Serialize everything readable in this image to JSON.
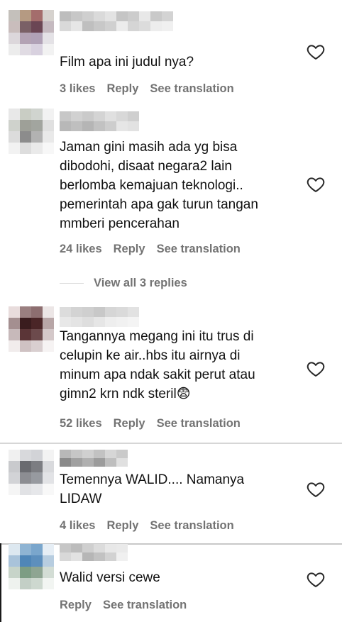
{
  "colors": {
    "meta_text": "#737373",
    "text": "#111111",
    "divider": "#d6d6d6"
  },
  "comments": [
    {
      "text": "Film apa ini judul nya?",
      "likes": "3 likes",
      "reply": "Reply",
      "translate": "See translation",
      "avatar": [
        "#c4c0bb",
        "#b59a82",
        "#a46d6c",
        "#d6d2ce",
        "#c9bdbc",
        "#7a6066",
        "#6b4654",
        "#c5bac0",
        "#dcd7db",
        "#b3a2b4",
        "#b0a1b6",
        "#e4e2e6",
        "#ececec",
        "#e0dbe3",
        "#d8d1df",
        "#f2f2f2"
      ],
      "username": [
        "#bdbdbd",
        "#d9d9d9",
        "#c7c7c7",
        "#e6e6e6",
        "#cfcfcf",
        "#bfbfbf",
        "#dadada",
        "#c8c8c8",
        "#e3e3e3",
        "#d0d0d0",
        "#c5c5c5",
        "#ececec",
        "#cccccc",
        "#d5d5d5",
        "#e8e8e8",
        "#dcdcdc",
        "#c9c9c9",
        "#ededed",
        "#d3d3d3",
        "#f0f0f0"
      ]
    },
    {
      "text": "Jaman gini masih ada yg bisa\ndibodohi, disaat negara2 lain\nberlomba kemajuan teknologi..\npemerintah apa gak turun tangan\nmmberi pencerahan",
      "likes": "24 likes",
      "reply": "Reply",
      "translate": "See translation",
      "avatar": [
        "#e8e8e8",
        "#c9cdc4",
        "#d0d4cf",
        "#f2f2f2",
        "#cfd2cc",
        "#9ea098",
        "#a2a59f",
        "#e0e0e0",
        "#dcdcdc",
        "#8c8c8c",
        "#b2b2b2",
        "#e9e9e9",
        "#f2f2f2",
        "#dddddd",
        "#eaeaea",
        "#f7f7f7"
      ],
      "username": [
        "#c7c7c7",
        "#b8b8b8",
        "#d1d1d1",
        "#bfbfbf",
        "#cacaca",
        "#b5b5b5",
        "#d4d4d4",
        "#c2c2c2",
        "#e0e0e0",
        "#cdcdcd",
        "#d8d8d8",
        "#e6e6e6",
        "#cfcfcf",
        "#e2e2e2"
      ]
    },
    {
      "text": "Tangannya megang ini itu trus di\ncelupin ke air..hbs itu airnya di\nminum apa ndak sakit perut atau\ngimn2 krn ndk steril😨",
      "likes": "52 likes",
      "reply": "Reply",
      "translate": "See translation",
      "avatar": [
        "#e8dcdc",
        "#9a7f80",
        "#8d6e70",
        "#ece6e6",
        "#a48f90",
        "#3a1c1e",
        "#4a2527",
        "#b8a6a7",
        "#c7b9ba",
        "#5b3537",
        "#6c4a4c",
        "#d4c8c9",
        "#f1ecec",
        "#cfc2c3",
        "#d9cfd0",
        "#f6f3f3"
      ],
      "username": [
        "#dcdcdc",
        "#e8e8e8",
        "#d3d3d3",
        "#e4e4e4",
        "#cfcfcf",
        "#dedede",
        "#c8c8c8",
        "#e6e6e6",
        "#d6d6d6",
        "#eeeeee",
        "#dadada",
        "#f1f1f1",
        "#e2e2e2",
        "#f4f4f4"
      ]
    },
    {
      "text": "Temennya WALID.... Namanya\nLIDAW",
      "likes": "4 likes",
      "reply": "Reply",
      "translate": "See translation",
      "avatar": [
        "#f0f0f0",
        "#d8d9dc",
        "#d2d3d7",
        "#f3f3f3",
        "#c9cacd",
        "#6a6b70",
        "#7c7d82",
        "#d9dadd",
        "#d2d3d6",
        "#8c8d92",
        "#979aa0",
        "#e2e3e6",
        "#f5f5f5",
        "#e1e2e5",
        "#e6e7ea",
        "#f8f8f8"
      ],
      "username": [
        "#b8b8b8",
        "#8a8a8a",
        "#c6c6c6",
        "#a0a0a0",
        "#d0d0d0",
        "#b0b0b0",
        "#c2c2c2",
        "#9c9c9c",
        "#d6d6d6",
        "#bebebe",
        "#cacaca",
        "#e0e0e0"
      ]
    },
    {
      "text": "Walid versi cewe",
      "likes": "",
      "reply": "Reply",
      "translate": "See translation",
      "avatar": [
        "#dde8f0",
        "#8fb4d3",
        "#7aa6cc",
        "#e6eef5",
        "#a9c3da",
        "#4f86b8",
        "#5d8fbd",
        "#b7cde0",
        "#c7d4c9",
        "#7d9d84",
        "#8ea592",
        "#d3ddd5",
        "#eef2ee",
        "#c3cfc6",
        "#cdd8cf",
        "#f2f5f2"
      ],
      "username": [
        "#c6c6c6",
        "#d8d8d8",
        "#bcbcbc",
        "#e2e2e2",
        "#cfcfcf",
        "#b6b6b6",
        "#dcdcdc",
        "#c2c2c2",
        "#e8e8e8",
        "#d2d2d2",
        "#eaeaea",
        "#f0f0f0"
      ]
    }
  ],
  "view_replies": "View all 3 replies"
}
